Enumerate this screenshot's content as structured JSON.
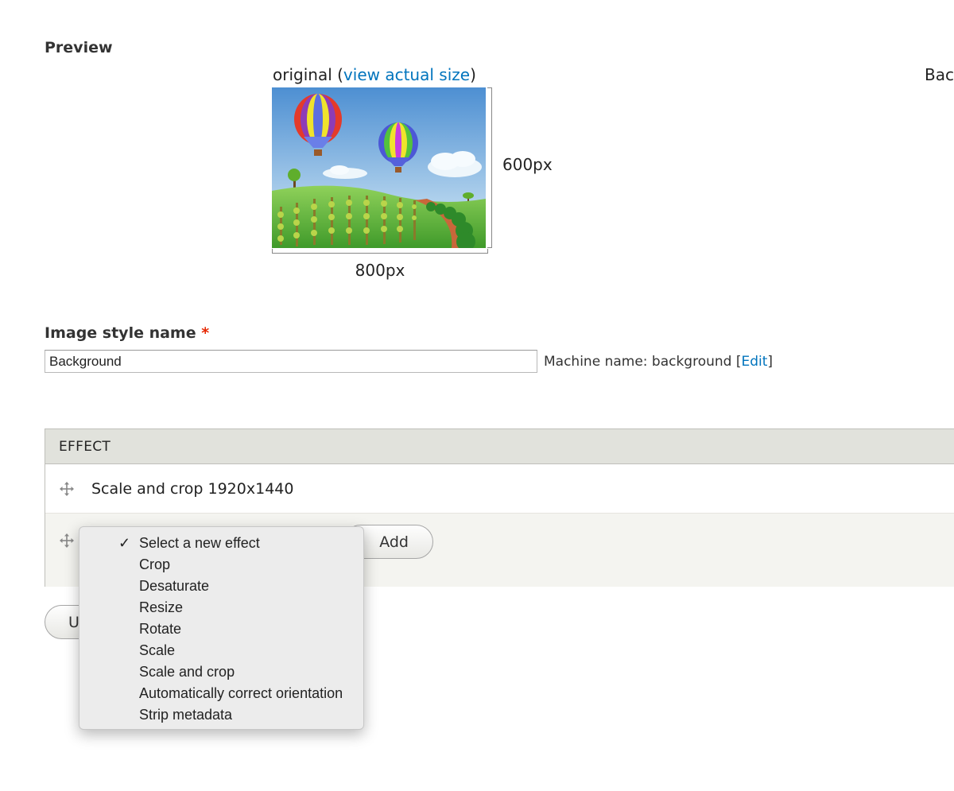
{
  "preview": {
    "heading": "Preview",
    "original_label": "original (",
    "view_actual_size_link": "view actual size",
    "original_label_close": ")",
    "second_label_partial": "Bac",
    "width_label": "800px",
    "height_label": "600px"
  },
  "style_name": {
    "label": "Image style name",
    "required_marker": "*",
    "value": "Background",
    "machine_name_prefix": "Machine name: background [",
    "edit_link": "Edit",
    "machine_name_suffix": "]"
  },
  "effects": {
    "column_header": "EFFECT",
    "rows": [
      {
        "label": "Scale and crop 1920x1440"
      }
    ],
    "add_button": "Add",
    "new_effect_select": {
      "options": [
        {
          "label": "Select a new effect",
          "selected": true
        },
        {
          "label": "Crop"
        },
        {
          "label": "Desaturate"
        },
        {
          "label": "Resize"
        },
        {
          "label": "Rotate"
        },
        {
          "label": "Scale"
        },
        {
          "label": "Scale and crop"
        },
        {
          "label": "Automatically correct orientation"
        },
        {
          "label": "Strip metadata"
        }
      ]
    }
  },
  "update_button": "U",
  "icons": {
    "drag_handle": "move-arrows-icon",
    "checkmark": "✓"
  },
  "colors": {
    "link": "#0074bd",
    "required": "#e62600",
    "table_header_bg": "#e1e2dc",
    "add_row_bg": "#f4f4f0"
  }
}
